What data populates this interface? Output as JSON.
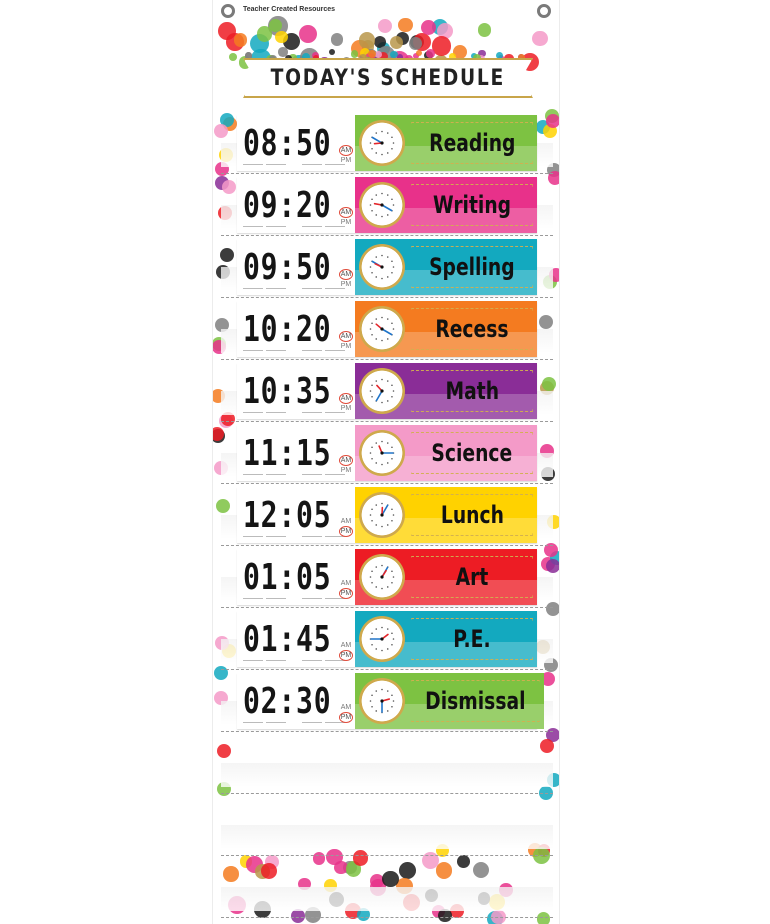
{
  "header": {
    "brand": "Teacher Created Resources",
    "title": "TODAY'S SCHEDULE"
  },
  "ampm_labels": {
    "am": "AM",
    "pm": "PM"
  },
  "schedule": [
    {
      "time": "08:50",
      "period": "AM",
      "subject": "Reading",
      "color": "#7dc242",
      "hour": 8,
      "minute": 50
    },
    {
      "time": "09:20",
      "period": "AM",
      "subject": "Writing",
      "color": "#e8318a",
      "hour": 9,
      "minute": 20
    },
    {
      "time": "09:50",
      "period": "AM",
      "subject": "Spelling",
      "color": "#13a9bf",
      "hour": 9,
      "minute": 50
    },
    {
      "time": "10:20",
      "period": "AM",
      "subject": "Recess",
      "color": "#f47b20",
      "hour": 10,
      "minute": 20
    },
    {
      "time": "10:35",
      "period": "AM",
      "subject": "Math",
      "color": "#8a2d97",
      "hour": 10,
      "minute": 35
    },
    {
      "time": "11:15",
      "period": "AM",
      "subject": "Science",
      "color": "#f49ac8",
      "hour": 11,
      "minute": 15
    },
    {
      "time": "12:05",
      "period": "PM",
      "subject": "Lunch",
      "color": "#ffd200",
      "hour": 12,
      "minute": 5
    },
    {
      "time": "01:05",
      "period": "PM",
      "subject": "Art",
      "color": "#ed1c24",
      "hour": 1,
      "minute": 5
    },
    {
      "time": "01:45",
      "period": "PM",
      "subject": "P.E.",
      "color": "#13a9bf",
      "hour": 1,
      "minute": 45
    },
    {
      "time": "02:30",
      "period": "PM",
      "subject": "Dismissal",
      "color": "#7dc242",
      "hour": 2,
      "minute": 30
    }
  ],
  "empty_pockets": 3,
  "confetti_colors": [
    "#7dc242",
    "#e8318a",
    "#13a9bf",
    "#f47b20",
    "#8a2d97",
    "#f49ac8",
    "#ffd200",
    "#ed1c24",
    "#1a1a1a",
    "#b8964a",
    "#808080"
  ]
}
